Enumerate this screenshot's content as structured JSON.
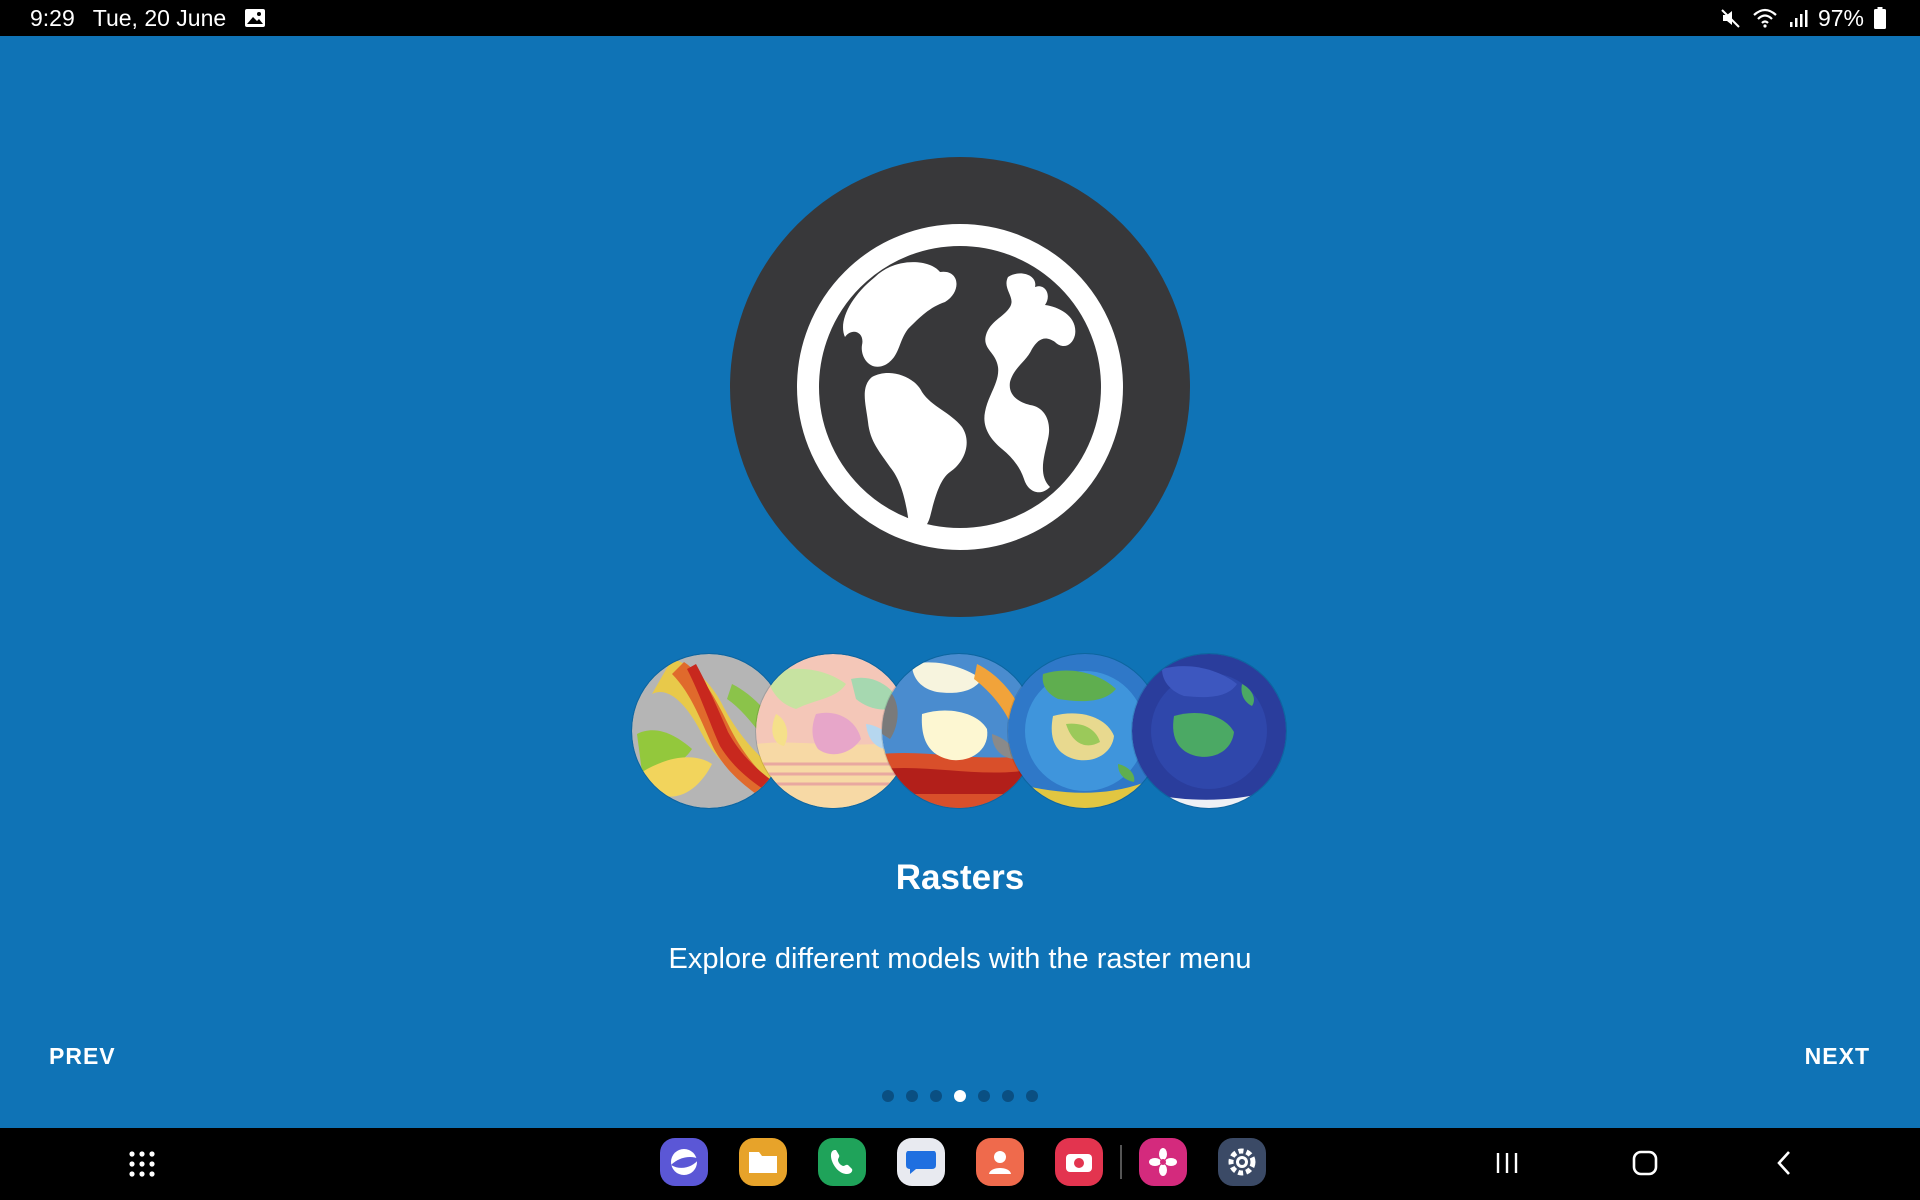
{
  "status_bar": {
    "time": "9:29",
    "date": "Tue, 20 June",
    "battery": "97%",
    "icons": [
      "gallery-notification-icon",
      "mute-icon",
      "wifi-icon",
      "signal-icon",
      "battery-icon"
    ]
  },
  "slide": {
    "hero_icon": "globe-icon",
    "title": "Rasters",
    "description": "Explore different models with the raster menu",
    "raster_previews": [
      "seafloor-age-raster",
      "geology-raster",
      "crustal-thickness-raster",
      "topography-raster",
      "bathymetry-raster"
    ]
  },
  "navigation": {
    "prev_label": "PREV",
    "next_label": "NEXT",
    "page_count": 7,
    "current_page": 4
  },
  "dock": {
    "apps": [
      "internet-app",
      "files-app",
      "phone-app",
      "messages-app",
      "contacts-app",
      "camera-app",
      "gallery-app",
      "settings-app"
    ]
  },
  "colors": {
    "background": "#0f73b6",
    "hero_circle": "#38383a",
    "dot_inactive": "#0a4f82",
    "dot_active": "#ffffff"
  }
}
